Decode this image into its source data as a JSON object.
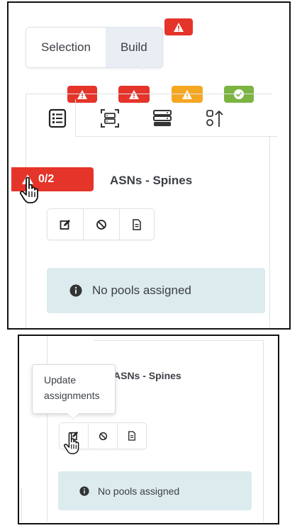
{
  "top_panel": {
    "toggle": {
      "selection_label": "Selection",
      "build_label": "Build",
      "active": "Build"
    },
    "tab_badges": [
      {
        "status": "error",
        "color": "#e5342a",
        "icon": "warning-icon"
      },
      {
        "status": "error",
        "color": "#e5342a",
        "icon": "warning-icon"
      },
      {
        "status": "warning",
        "color": "#f5a623",
        "icon": "warning-icon"
      },
      {
        "status": "ok",
        "color": "#7cb342",
        "icon": "check-icon"
      }
    ],
    "tabs": [
      {
        "icon": "list-icon"
      },
      {
        "icon": "device-icon"
      },
      {
        "icon": "rack-icon"
      },
      {
        "icon": "sort-icon"
      }
    ],
    "error_chip": {
      "count": "0/2"
    },
    "section_title": "ASNs - Spines",
    "info_text": "No pools assigned"
  },
  "bottom_panel": {
    "tooltip_text": "Update assignments",
    "section_title": "ASNs - Spines",
    "info_text": "No pools assigned"
  },
  "colors": {
    "error": "#e5342a",
    "warning": "#f5a623",
    "success": "#7cb342",
    "info_bg": "#dcebed"
  }
}
